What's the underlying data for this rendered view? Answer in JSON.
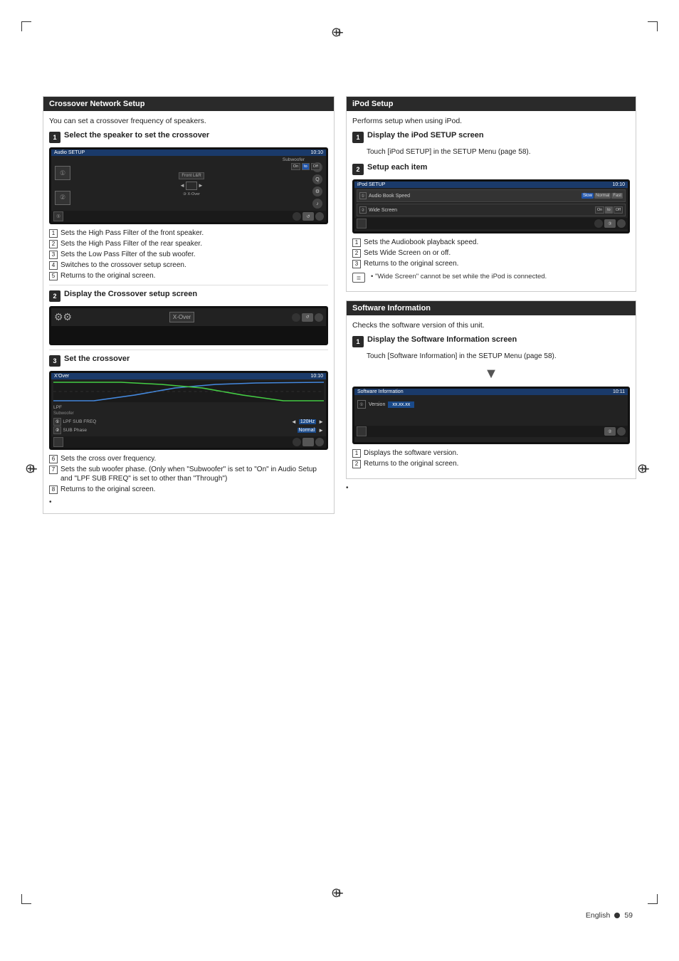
{
  "page": {
    "language": "English",
    "page_number": "59",
    "footer_text": "English"
  },
  "left_section": {
    "title": "Crossover Network Setup",
    "intro": "You can set a crossover frequency of speakers.",
    "steps": [
      {
        "num": "1",
        "title": "Select the speaker to set the crossover",
        "screen_title": "Audio SETUP",
        "screen_time": "10:10",
        "items": [
          {
            "num": "1",
            "text": "Sets the High Pass Filter of the front speaker."
          },
          {
            "num": "2",
            "text": "Sets the High Pass Filter of the rear speaker."
          },
          {
            "num": "3",
            "text": "Sets the Low Pass Filter of the sub woofer."
          },
          {
            "num": "4",
            "text": "Switches to the crossover setup screen."
          },
          {
            "num": "5",
            "text": "Returns to the original screen."
          }
        ]
      },
      {
        "num": "2",
        "title": "Display the Crossover setup screen",
        "screen_title": "",
        "screen_time": ""
      },
      {
        "num": "3",
        "title": "Set the crossover",
        "screen_title": "X'Over",
        "screen_time": "10:10",
        "lpf_label": "LPF",
        "subwoofer_label": "Subwoofer",
        "lpf_freq_label": "LPF SUB FREQ",
        "freq_val": "120Hz",
        "sub_phase_label": "SUB Phase",
        "sub_phase_val": "Normal",
        "items": [
          {
            "num": "6",
            "text": "Sets the cross over frequency."
          },
          {
            "num": "7",
            "text": "Sets the sub woofer phase. (Only when \"Subwoofer\" is set to \"On\" in Audio Setup and \"LPF SUB FREQ\" is set to other than \"Through\")"
          },
          {
            "num": "8",
            "text": "Returns to the original screen."
          }
        ]
      }
    ]
  },
  "right_section": {
    "ipod_setup": {
      "title": "iPod Setup",
      "intro": "Performs setup when using iPod.",
      "steps": [
        {
          "num": "1",
          "title": "Display the iPod SETUP screen",
          "detail": "Touch [iPod SETUP] in the SETUP Menu (page 58)."
        },
        {
          "num": "2",
          "title": "Setup each item",
          "screen_title": "iPod SETUP",
          "screen_time": "10:10",
          "audiobook_label": "Audio Book Speed",
          "slow_btn": "Slow",
          "normal_btn": "Normal",
          "fast_btn": "Fast",
          "wide_screen_label": "Wide Screen",
          "items": [
            {
              "num": "1",
              "text": "Sets the Audiobook playback speed."
            },
            {
              "num": "2",
              "text": "Sets Wide Screen on or off."
            },
            {
              "num": "3",
              "text": "Returns to the original screen."
            }
          ],
          "note_icon": "≣",
          "note_text": "\"Wide Screen\" cannot be set while the iPod is connected."
        }
      ]
    },
    "software_info": {
      "title": "Software Information",
      "intro": "Checks the software version of this unit.",
      "steps": [
        {
          "num": "1",
          "title": "Display the Software Information screen",
          "detail": "Touch [Software Information] in the SETUP Menu (page 58).",
          "screen_title": "Software Information",
          "screen_time": "10:11",
          "version_label": "Version",
          "version_val": "xx.xx.xx",
          "items": [
            {
              "num": "1",
              "text": "Displays the software version."
            },
            {
              "num": "2",
              "text": "Returns to the original screen."
            }
          ]
        }
      ]
    }
  }
}
